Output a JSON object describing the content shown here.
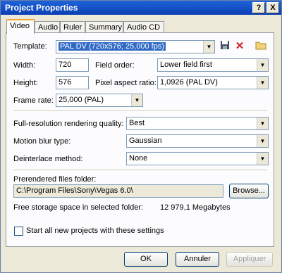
{
  "window": {
    "title": "Project Properties"
  },
  "titlebar": {
    "help": "?",
    "close": "X"
  },
  "tabs": [
    {
      "label": "Video"
    },
    {
      "label": "Audio"
    },
    {
      "label": "Ruler"
    },
    {
      "label": "Summary"
    },
    {
      "label": "Audio CD"
    }
  ],
  "video": {
    "template_label": "Template:",
    "template_value": "PAL DV (720x576; 25,000 fps)",
    "width_label": "Width:",
    "width_value": "720",
    "height_label": "Height:",
    "height_value": "576",
    "field_order_label": "Field order:",
    "field_order_value": "Lower field first",
    "pixel_aspect_label": "Pixel aspect ratio:",
    "pixel_aspect_value": "1,0926 (PAL DV)",
    "frame_rate_label": "Frame rate:",
    "frame_rate_value": "25,000 (PAL)",
    "render_quality_label": "Full-resolution rendering quality:",
    "render_quality_value": "Best",
    "motion_blur_label": "Motion blur type:",
    "motion_blur_value": "Gaussian",
    "deinterlace_label": "Deinterlace method:",
    "deinterlace_value": "None",
    "prerendered_label": "Prerendered files folder:",
    "prerendered_value": "C:\\Program Files\\Sony\\Vegas 6.0\\",
    "browse_label": "Browse...",
    "free_space_label": "Free storage space in selected folder:",
    "free_space_value": "12 979,1 Megabytes",
    "start_all_label": "Start all new projects with these settings"
  },
  "buttons": {
    "ok": "OK",
    "cancel": "Annuler",
    "apply": "Appliquer"
  },
  "icons": {
    "save": "save-icon",
    "delete": "delete-icon",
    "folder": "folder-icon"
  },
  "colors": {
    "titlebar": "#0a3fb4",
    "selection": "#316ac5",
    "delete_red": "#d0202a"
  }
}
